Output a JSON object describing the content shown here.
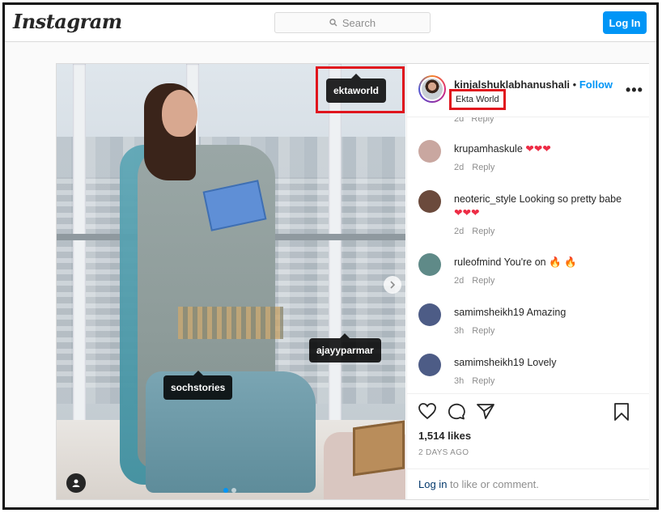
{
  "header": {
    "logo": "Instagram",
    "search_placeholder": "Search",
    "login_label": "Log In"
  },
  "post": {
    "tags": [
      "ektaworld",
      "ajayyparmar",
      "sochstories"
    ],
    "author": {
      "username": "kinjalshuklabhanushali",
      "bullet": "•",
      "follow_label": "Follow",
      "location": "Ekta World",
      "more": "•••"
    },
    "partial_reply": "2d   Reply",
    "comments": [
      {
        "user": "krupamhaskule",
        "text": "",
        "hearts": "❤❤❤",
        "age": "2d",
        "reply": "Reply",
        "avatar_color": "#c9a7a0"
      },
      {
        "user": "neoteric_style",
        "text": "Looking so pretty babe",
        "hearts": "❤❤❤",
        "age": "2d",
        "reply": "Reply",
        "avatar_color": "#6b4a3c"
      },
      {
        "user": "ruleofmind",
        "text": "You're on 🔥 🔥",
        "hearts": "",
        "age": "2d",
        "reply": "Reply",
        "avatar_color": "#5f8a88"
      },
      {
        "user": "samimsheikh19",
        "text": "Amazing",
        "hearts": "",
        "age": "3h",
        "reply": "Reply",
        "avatar_color": "#4d5c86"
      },
      {
        "user": "samimsheikh19",
        "text": "Lovely",
        "hearts": "",
        "age": "3h",
        "reply": "Reply",
        "avatar_color": "#4d5c86"
      }
    ],
    "likes": "1,514 likes",
    "time": "2 DAYS AGO",
    "login_prompt": {
      "link": "Log in",
      "rest": " to like or comment."
    }
  },
  "colors": {
    "accent": "#0095f6",
    "highlight_box": "#e0151d",
    "heart": "#ed2c45"
  },
  "icons": [
    "search-icon",
    "heart-icon",
    "comment-icon",
    "share-icon",
    "bookmark-icon",
    "more-icon",
    "user-tag-icon",
    "chevron-right-icon"
  ]
}
